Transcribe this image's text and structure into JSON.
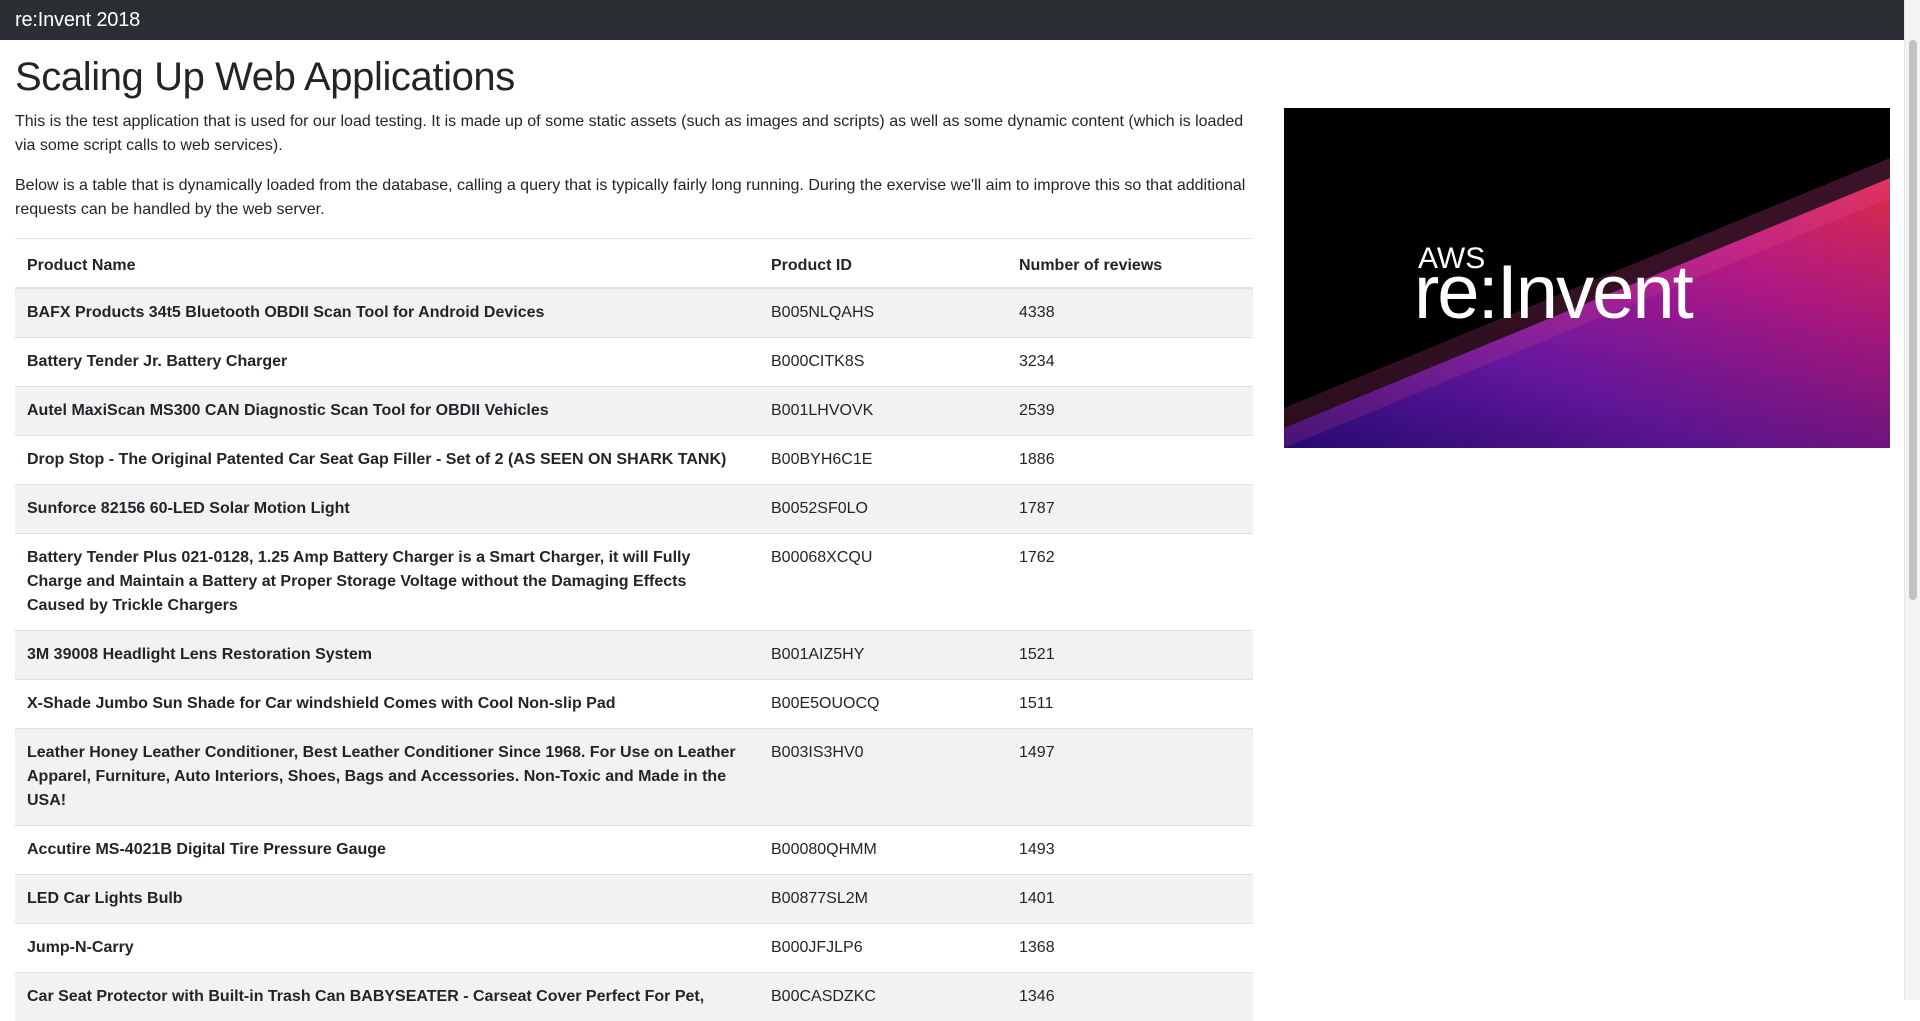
{
  "navbar": {
    "brand": "re:Invent 2018"
  },
  "main": {
    "title": "Scaling Up Web Applications",
    "intro": "This is the test application that is used for our load testing. It is made up of some static assets (such as images and scripts) as well as some dynamic content (which is loaded via some script calls to web services).",
    "description": "Below is a table that is dynamically loaded from the database, calling a query that is typically fairly long running. During the exervise we'll aim to improve this so that additional requests can be handled by the web server."
  },
  "table": {
    "headers": [
      "Product Name",
      "Product ID",
      "Number of reviews"
    ],
    "rows": [
      {
        "name": "BAFX Products 34t5 Bluetooth OBDII Scan Tool for Android Devices",
        "id": "B005NLQAHS",
        "reviews": "4338"
      },
      {
        "name": "Battery Tender Jr. Battery Charger",
        "id": "B000CITK8S",
        "reviews": "3234"
      },
      {
        "name": "Autel MaxiScan MS300 CAN Diagnostic Scan Tool for OBDII Vehicles",
        "id": "B001LHVOVK",
        "reviews": "2539"
      },
      {
        "name": "Drop Stop - The Original Patented Car Seat Gap Filler - Set of 2 (AS SEEN ON SHARK TANK)",
        "id": "B00BYH6C1E",
        "reviews": "1886"
      },
      {
        "name": "Sunforce 82156 60-LED Solar Motion Light",
        "id": "B0052SF0LO",
        "reviews": "1787"
      },
      {
        "name": "Battery Tender Plus 021-0128, 1.25 Amp Battery Charger is a Smart Charger, it will Fully Charge and Maintain a Battery at Proper Storage Voltage without the Damaging Effects Caused by Trickle Chargers",
        "id": "B00068XCQU",
        "reviews": "1762"
      },
      {
        "name": "3M 39008 Headlight Lens Restoration System",
        "id": "B001AIZ5HY",
        "reviews": "1521"
      },
      {
        "name": "X-Shade Jumbo Sun Shade for Car windshield Comes with Cool Non-slip Pad",
        "id": "B00E5OUOCQ",
        "reviews": "1511"
      },
      {
        "name": "Leather Honey Leather Conditioner, Best Leather Conditioner Since 1968. For Use on Leather Apparel, Furniture, Auto Interiors, Shoes, Bags and Accessories. Non-Toxic and Made in the USA!",
        "id": "B003IS3HV0",
        "reviews": "1497"
      },
      {
        "name": "Accutire MS-4021B Digital Tire Pressure Gauge",
        "id": "B00080QHMM",
        "reviews": "1493"
      },
      {
        "name": "LED Car Lights Bulb",
        "id": "B00877SL2M",
        "reviews": "1401"
      },
      {
        "name": "Jump-N-Carry",
        "id": "B000JFJLP6",
        "reviews": "1368"
      },
      {
        "name": "Car Seat Protector with Built-in Trash Can BABYSEATER - Carseat Cover Perfect For Pet,",
        "id": "B00CASDZKC",
        "reviews": "1346"
      }
    ]
  },
  "banner": {
    "line1": "AWS",
    "line2": "re:Invent"
  }
}
